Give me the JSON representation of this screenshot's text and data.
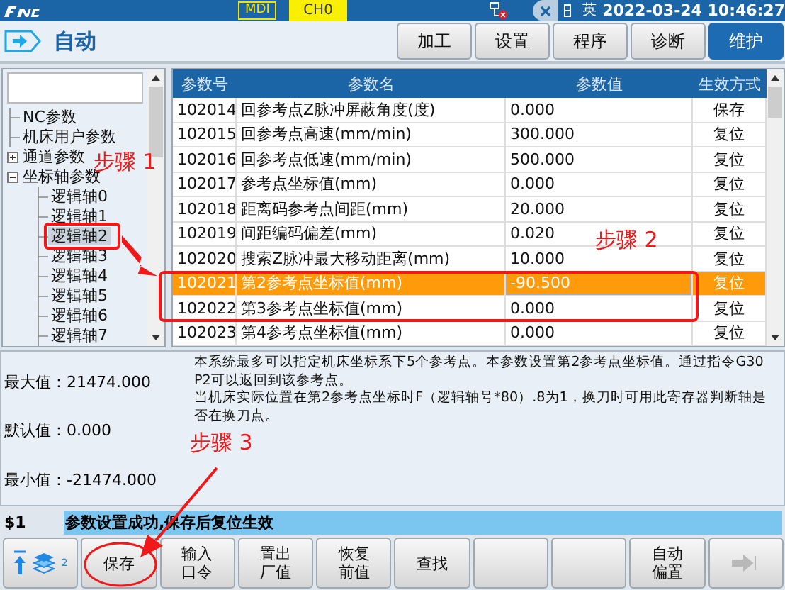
{
  "top_bar": {
    "mode": "MDI",
    "channel": "CH0",
    "input_method": "英",
    "datetime": "2022-03-24 10:46:27"
  },
  "header": {
    "title": "自动",
    "tabs": [
      {
        "label": "加工",
        "selected": false
      },
      {
        "label": "设置",
        "selected": false
      },
      {
        "label": "程序",
        "selected": false
      },
      {
        "label": "诊断",
        "selected": false
      },
      {
        "label": "维护",
        "selected": true
      }
    ]
  },
  "tree": {
    "items": [
      {
        "label": "NC参数",
        "selected": false
      },
      {
        "label": "机床用户参数",
        "selected": false
      },
      {
        "label": "通道参数",
        "expanded": false,
        "selected": false
      },
      {
        "label": "坐标轴参数",
        "expanded": true,
        "selected": false,
        "children": [
          {
            "label": "逻辑轴0",
            "selected": false
          },
          {
            "label": "逻辑轴1",
            "selected": false
          },
          {
            "label": "逻辑轴2",
            "selected": true
          },
          {
            "label": "逻辑轴3",
            "selected": false
          },
          {
            "label": "逻辑轴4",
            "selected": false
          },
          {
            "label": "逻辑轴5",
            "selected": false
          },
          {
            "label": "逻辑轴6",
            "selected": false
          },
          {
            "label": "逻辑轴7",
            "selected": false
          }
        ]
      }
    ]
  },
  "table": {
    "columns": [
      "参数号",
      "参数名",
      "参数值",
      "生效方式"
    ],
    "rows": [
      {
        "cells": [
          "102014",
          "回参考点Z脉冲屏蔽角度(度)",
          "0.000",
          "保存"
        ],
        "selected": false
      },
      {
        "cells": [
          "102015",
          "回参考点高速(mm/min)",
          "300.000",
          "复位"
        ],
        "selected": false
      },
      {
        "cells": [
          "102016",
          "回参考点低速(mm/min)",
          "500.000",
          "复位"
        ],
        "selected": false
      },
      {
        "cells": [
          "102017",
          "参考点坐标值(mm)",
          "0.000",
          "复位"
        ],
        "selected": false
      },
      {
        "cells": [
          "102018",
          "距离码参考点间距(mm)",
          "20.000",
          "复位"
        ],
        "selected": false
      },
      {
        "cells": [
          "102019",
          "间距编码偏差(mm)",
          "0.020",
          "复位"
        ],
        "selected": false
      },
      {
        "cells": [
          "102020",
          "搜索Z脉冲最大移动距离(mm)",
          "10.000",
          "复位"
        ],
        "selected": false
      },
      {
        "cells": [
          "102021",
          "第2参考点坐标值(mm)",
          "-90.500",
          "复位"
        ],
        "selected": true
      },
      {
        "cells": [
          "102022",
          "第3参考点坐标值(mm)",
          "0.000",
          "复位"
        ],
        "selected": false
      },
      {
        "cells": [
          "102023",
          "第4参考点坐标值(mm)",
          "0.000",
          "复位"
        ],
        "selected": false
      }
    ]
  },
  "info": {
    "limits": [
      {
        "label": "最大值：",
        "value": "21474.000"
      },
      {
        "label": "默认值：",
        "value": "0.000"
      },
      {
        "label": "最小值：",
        "value": "-21474.000"
      }
    ],
    "description": [
      "本系统最多可以指定机床坐标系下5个参考点。本参数设置第2参考点坐标值。通过指令G30 P2可以返回到该参考点。",
      "当机床实际位置在第2参考点坐标时F（逻辑轴号*80）.8为1，换刀时可用此寄存器判断轴是否在换刀点。"
    ]
  },
  "status": {
    "channel": "$1",
    "message": "参数设置成功,保存后复位生效"
  },
  "softkeys": [
    {
      "kind": "icons",
      "badge": "2"
    },
    {
      "kind": "text",
      "lines": [
        "保存"
      ]
    },
    {
      "kind": "text",
      "lines": [
        "输入",
        "口令"
      ]
    },
    {
      "kind": "text",
      "lines": [
        "置出",
        "厂值"
      ]
    },
    {
      "kind": "text",
      "lines": [
        "恢复",
        "前值"
      ]
    },
    {
      "kind": "text",
      "lines": [
        "查找"
      ]
    },
    {
      "kind": "blank"
    },
    {
      "kind": "blank"
    },
    {
      "kind": "text",
      "lines": [
        "自动",
        "偏置"
      ]
    },
    {
      "kind": "next",
      "disabled": true
    }
  ],
  "annotations": [
    {
      "text": "步骤 1"
    },
    {
      "text": "步骤 2"
    },
    {
      "text": "步骤 3"
    }
  ]
}
